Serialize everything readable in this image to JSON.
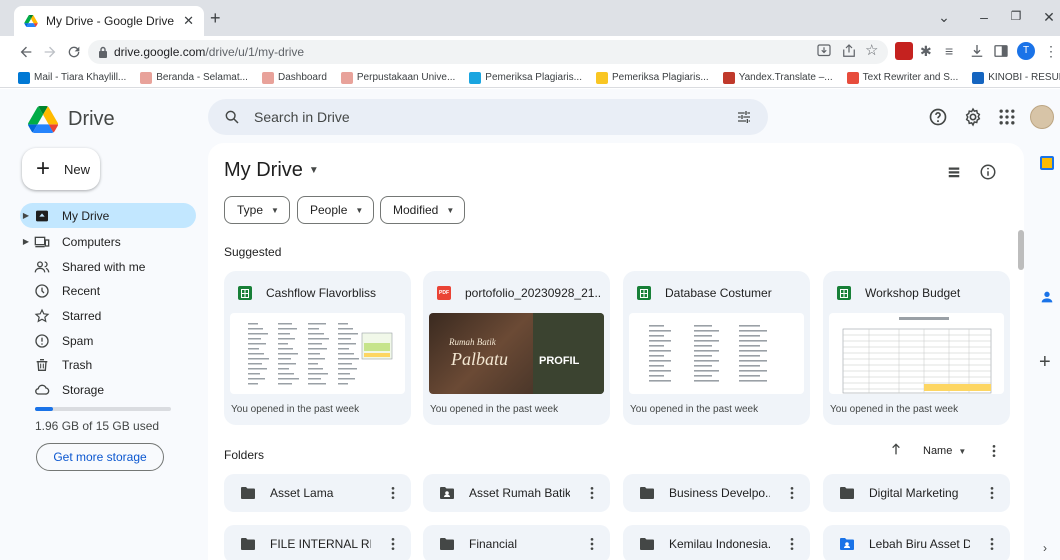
{
  "browser": {
    "tab_title": "My Drive - Google Drive",
    "url_host": "drive.google.com",
    "url_path": "/drive/u/1/my-drive",
    "profile_initial": "T"
  },
  "bookmarks": [
    {
      "label": "Mail - Tiara Khaylill...",
      "color": "#0078d4"
    },
    {
      "label": "Beranda - Selamat...",
      "color": "#e8a29a"
    },
    {
      "label": "Dashboard",
      "color": "#e8a29a"
    },
    {
      "label": "Perpustakaan Unive...",
      "color": "#e8a29a"
    },
    {
      "label": "Pemeriksa Plagiaris...",
      "color": "#1aa5e0"
    },
    {
      "label": "Pemeriksa Plagiaris...",
      "color": "#f9c623"
    },
    {
      "label": "Yandex.Translate –...",
      "color": "#c0392b"
    },
    {
      "label": "Text Rewriter and S...",
      "color": "#e74c3c"
    },
    {
      "label": "KINOBI - RESUME T...",
      "color": "#1565c0"
    }
  ],
  "app": {
    "name": "Drive",
    "search_placeholder": "Search in Drive"
  },
  "sidebar": {
    "new_label": "New",
    "items": [
      {
        "label": "My Drive",
        "active": true
      },
      {
        "label": "Computers"
      },
      {
        "label": "Shared with me"
      },
      {
        "label": "Recent"
      },
      {
        "label": "Starred"
      },
      {
        "label": "Spam"
      },
      {
        "label": "Trash"
      },
      {
        "label": "Storage"
      }
    ],
    "storage_text": "1.96 GB of 15 GB used",
    "storage_fraction": 0.13,
    "get_storage_label": "Get more storage"
  },
  "main": {
    "title": "My Drive",
    "filters": [
      "Type",
      "People",
      "Modified"
    ],
    "suggested_label": "Suggested",
    "suggested": [
      {
        "name": "Cashflow Flavorbliss",
        "kind": "sheet",
        "footer": "You opened in the past week"
      },
      {
        "name": "portofolio_20230928_21...",
        "kind": "pdf",
        "footer": "You opened in the past week",
        "thumb_script": "Rumah Batik",
        "thumb_name": "Palbatu",
        "thumb_label": "PROFIL"
      },
      {
        "name": "Database Costumer",
        "kind": "sheet",
        "footer": "You opened in the past week"
      },
      {
        "name": "Workshop Budget",
        "kind": "sheet",
        "footer": "You opened in the past week"
      }
    ],
    "folders_label": "Folders",
    "sort_label": "Name",
    "folders": [
      {
        "name": "Asset Lama",
        "kind": "plain"
      },
      {
        "name": "Asset Rumah Batik...",
        "kind": "shared"
      },
      {
        "name": "Business Develpo...",
        "kind": "plain"
      },
      {
        "name": "Digital Marketing",
        "kind": "plain"
      },
      {
        "name": "FILE INTERNAL RBP",
        "kind": "plain"
      },
      {
        "name": "Financial",
        "kind": "plain"
      },
      {
        "name": "Kemilau Indonesia...",
        "kind": "plain"
      },
      {
        "name": "Lebah Biru Asset D...",
        "kind": "shared-blue"
      }
    ]
  }
}
